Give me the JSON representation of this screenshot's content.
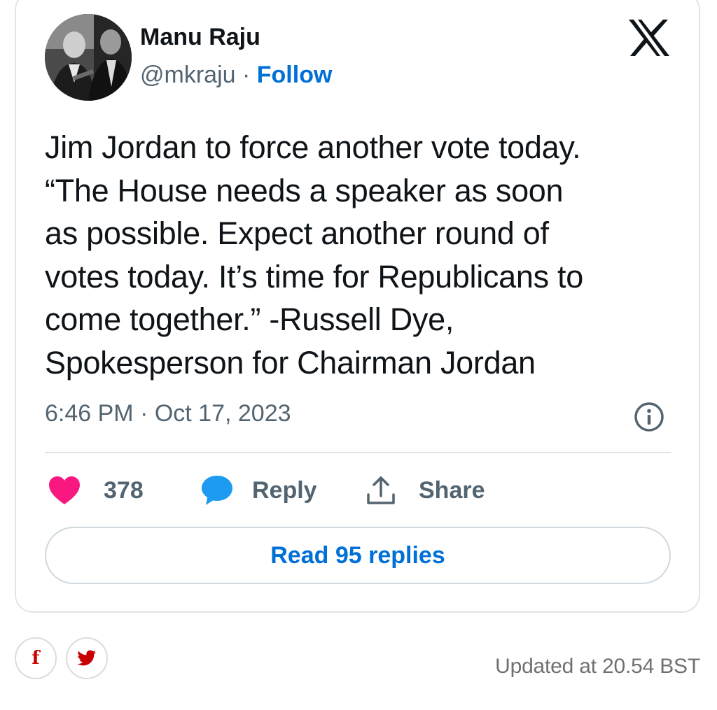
{
  "embed": {
    "author_name": "Manu Raju",
    "handle": "@mkraju",
    "separator": "·",
    "follow_label": "Follow",
    "tweet_lines": [
      "Jim Jordan to force another vote today.",
      "“The House needs a speaker as soon",
      "as possible. Expect another round of",
      "votes today. It’s time for Republicans to",
      "come together.” -Russell Dye,",
      "Spokesperson for Chairman Jordan"
    ],
    "timestamp": "6:46 PM · Oct 17, 2023",
    "like_count": "378",
    "reply_label": "Reply",
    "share_label": "Share",
    "read_replies_label": "Read 95 replies",
    "icons": {
      "brand": "x-logo-icon",
      "info": "info-icon",
      "like": "heart-icon",
      "reply": "speech-bubble-icon",
      "share": "share-upload-icon"
    },
    "colors": {
      "link": "#006fd6",
      "heart": "#f91880",
      "reply_bubble": "#1d9bf0",
      "secondary_text": "#536471"
    }
  },
  "article_footer": {
    "share_buttons": [
      {
        "icon": "facebook-icon",
        "glyph": "f"
      },
      {
        "icon": "twitter-bird-icon"
      }
    ],
    "updated_text": "Updated at 20.54 BST",
    "accent": "#c70000"
  }
}
